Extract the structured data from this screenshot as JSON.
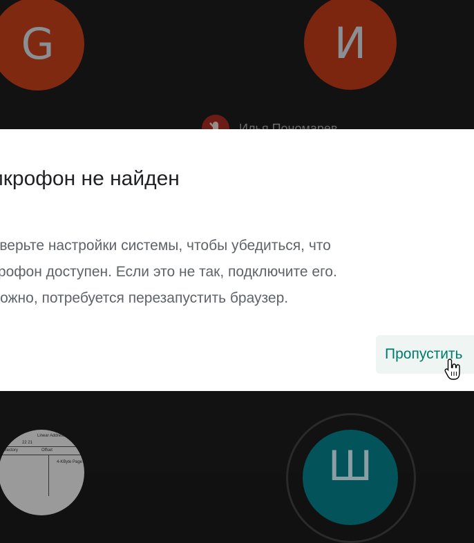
{
  "participants": {
    "top_left": {
      "initial": "G"
    },
    "top_right": {
      "initial": "И",
      "name": "Илья Пономарев"
    },
    "bottom_right": {
      "initial": "Ш"
    }
  },
  "shared_screen_thumbnail": {
    "line1": "Linear Address",
    "line2": "22  21",
    "line3": "Directory",
    "line4": "Offset",
    "line5": "4-KByte Page"
  },
  "dialog": {
    "title": "икрофон не найден",
    "body_lines": [
      "роверьте настройки системы, чтобы убедиться, что",
      "икрофон доступен. Если это не так, подключите его.",
      "зможно, потребуется перезапустить браузер."
    ],
    "skip_label": "Пропустить"
  },
  "colors": {
    "accent": "#00796b",
    "dialog_bg": "#ffffff",
    "backdrop": "#111111"
  },
  "icons": [
    "mic-off-icon",
    "hand-cursor-icon"
  ]
}
